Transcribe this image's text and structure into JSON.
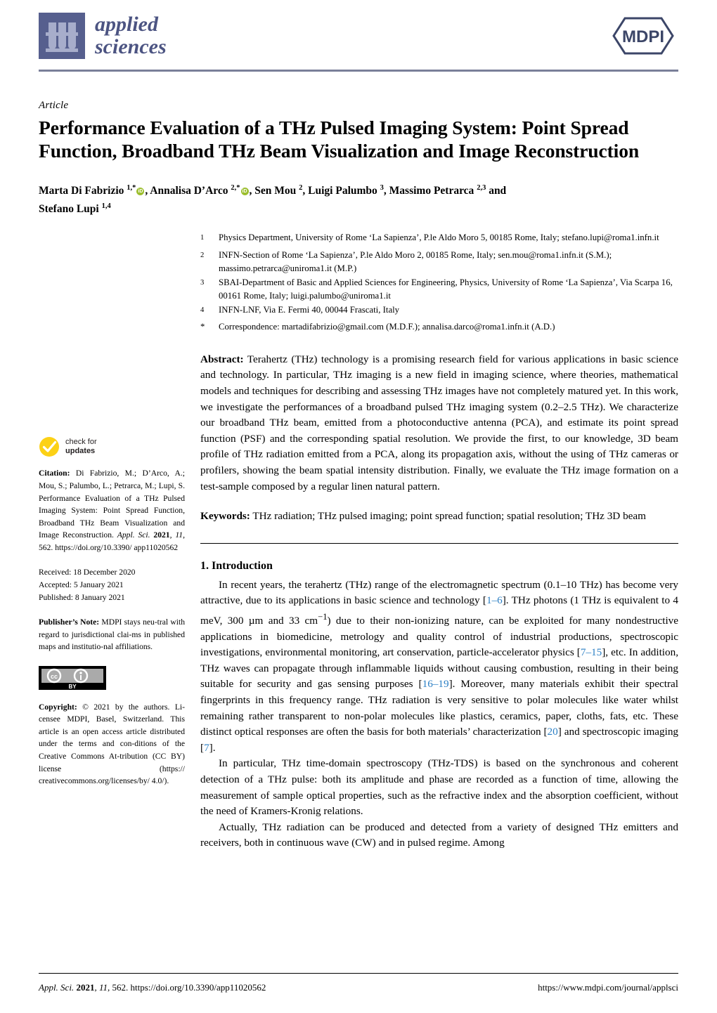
{
  "journal": {
    "name_line1": "applied",
    "name_line2": "sciences",
    "publisher_mark": "MDPI",
    "logo_icon": "test-tube-rack-icon"
  },
  "article": {
    "kind": "Article",
    "title": "Performance Evaluation of a THz Pulsed Imaging System: Point Spread Function, Broadband THz Beam Visualization and Image Reconstruction",
    "authors_line1_a": "Marta Di Fabrizio ",
    "authors_line1_sup1": "1,*",
    "authors_line1_b": ", Annalisa D’Arco ",
    "authors_line1_sup2": "2,*",
    "authors_line1_c": ", Sen Mou ",
    "authors_line1_sup3": "2",
    "authors_line1_d": ", Luigi Palumbo ",
    "authors_line1_sup4": "3",
    "authors_line1_e": ", Massimo Petrarca ",
    "authors_line1_sup5": "2,3",
    "authors_line1_f": " and",
    "authors_line2": "Stefano Lupi ",
    "authors_line2_sup": "1,4",
    "orcid_label": "iD"
  },
  "affiliations": [
    {
      "marker": "1",
      "text": "Physics Department, University of Rome ‘La Sapienza’, P.le Aldo Moro 5, 00185 Rome, Italy; stefano.lupi@roma1.infn.it"
    },
    {
      "marker": "2",
      "text": "INFN-Section of Rome ‘La Sapienza’, P.le Aldo Moro 2, 00185 Rome, Italy; sen.mou@roma1.infn.it (S.M.); massimo.petrarca@uniroma1.it (M.P.)"
    },
    {
      "marker": "3",
      "text": "SBAI-Department of Basic and Applied Sciences for Engineering, Physics, University of Rome ‘La Sapienza’, Via Scarpa 16, 00161 Rome, Italy; luigi.palumbo@uniroma1.it"
    },
    {
      "marker": "4",
      "text": "INFN-LNF, Via E. Fermi 40, 00044 Frascati, Italy"
    },
    {
      "marker": "*",
      "text": "Correspondence: martadifabrizio@gmail.com (M.D.F.); annalisa.darco@roma1.infn.it (A.D.)"
    }
  ],
  "abstract": {
    "label": "Abstract:",
    "text": " Terahertz (THz) technology is a promising research field for various applications in basic science and technology. In particular, THz imaging is a new field in imaging science, where theories, mathematical models and techniques for describing and assessing THz images have not completely matured yet. In this work, we investigate the performances of a broadband pulsed THz imaging system (0.2–2.5 THz). We characterize our broadband THz beam, emitted from a photoconductive antenna (PCA), and estimate its point spread function (PSF) and the corresponding spatial resolution. We provide the first, to our knowledge, 3D beam profile of THz radiation emitted from a PCA, along its propagation axis, without the using of THz cameras or profilers, showing the beam spatial intensity distribution. Finally, we evaluate the THz image formation on a test-sample composed by a regular linen natural pattern."
  },
  "keywords": {
    "label": "Keywords:",
    "text": " THz radiation; THz pulsed imaging; point spread function; spatial resolution; THz 3D beam"
  },
  "sidebar": {
    "check_for_updates": {
      "line1": "check for",
      "line2": "updates",
      "icon": "check-circle-icon"
    },
    "citation": {
      "label": "Citation:",
      "text_before_italic": " Di Fabrizio, M.; D’Arco, A.; Mou, S.; Palumbo, L.; Petrarca, M.; Lupi, S. Performance Evaluation of a THz Pulsed Imaging System: Point Spread Function, Broadband THz Beam Visualization and Image Reconstruction. ",
      "journal_italic": "Appl. Sci.",
      "year": " 2021",
      "volume": ", 11",
      "text_after": ", 562. https://doi.org/10.3390/ app11020562"
    },
    "dates": {
      "received": "Received: 18 December 2020",
      "accepted": "Accepted: 5 January 2021",
      "published": "Published: 8 January 2021"
    },
    "publishers_note": {
      "label": "Publisher’s Note:",
      "text": " MDPI stays neu-tral with regard to jurisdictional clai-ms in published maps and institutio-nal affiliations."
    },
    "copyright": {
      "badge_icon": "creative-commons-by-icon",
      "badge_cc": "cc",
      "badge_by": "BY",
      "label": "Copyright:",
      "text": " © 2021 by the authors. Li-censee MDPI, Basel, Switzerland. This article is an open access article distributed under the terms and con-ditions of the Creative Commons At-tribution (CC BY) license (https:// creativecommons.org/licenses/by/ 4.0/)."
    }
  },
  "introduction": {
    "heading": "1. Introduction",
    "para1_a": "In recent years, the terahertz (THz) range of the electromagnetic spectrum (0.1–10 THz) has become very attractive, due to its applications in basic science and technology [",
    "para1_ref1": "1–6",
    "para1_b": "]. THz photons (1 THz is equivalent to 4 meV, 300 µm and 33 cm",
    "para1_sup": "−1",
    "para1_c": ") due to their non-ionizing nature, can be exploited for many nondestructive applications in biomedicine, metrology and quality control of industrial productions, spectroscopic investigations, environmental monitoring, art conservation, particle-accelerator physics [",
    "para1_ref2": "7–15",
    "para1_d": "], etc. In addition, THz waves can propagate through inflammable liquids without causing combustion, resulting in their being suitable for security and gas sensing purposes [",
    "para1_ref3": "16–19",
    "para1_e": "]. Moreover, many materials exhibit their spectral fingerprints in this frequency range. THz radiation is very sensitive to polar molecules like water whilst remaining rather transparent to non-polar molecules like plastics, ceramics, paper, cloths, fats, etc. These distinct optical responses are often the basis for both materials’ characterization [",
    "para1_ref4": "20",
    "para1_f": "] and spectroscopic imaging [",
    "para1_ref5": "7",
    "para1_g": "].",
    "para2": "In particular, THz time-domain spectroscopy (THz-TDS) is based on the synchronous and coherent detection of a THz pulse: both its amplitude and phase are recorded as a function of time, allowing the measurement of sample optical properties, such as the refractive index and the absorption coefficient, without the need of Kramers-Kronig relations.",
    "para3": "Actually, THz radiation can be produced and detected from a variety of designed THz emitters and receivers, both in continuous wave (CW) and in pulsed regime. Among"
  },
  "footer": {
    "left_italic": "Appl. Sci.",
    "left_year": " 2021",
    "left_vol": ", 11",
    "left_rest": ", 562. https://doi.org/10.3390/app11020562",
    "right": "https://www.mdpi.com/journal/applsci"
  },
  "colors": {
    "journal_blue": "#4c5482",
    "logo_square": "#565f8e",
    "mdpi_navy": "#3c4668",
    "reference_link": "#2b7fc4",
    "orcid_green": "#9cbe2e",
    "check_yellow": "#fcd116"
  }
}
